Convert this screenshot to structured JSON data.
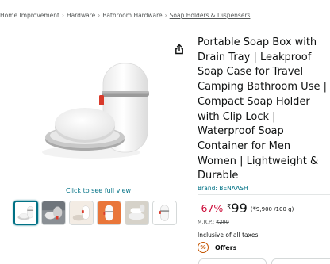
{
  "breadcrumb": [
    {
      "label": "Home Improvement"
    },
    {
      "label": "Hardware"
    },
    {
      "label": "Bathroom Hardware"
    },
    {
      "label": "Soap Holders & Dispensers"
    }
  ],
  "breadcrumb_separator": "›",
  "gallery": {
    "see_full_view": "Click to see full view",
    "thumbnail_count": 6,
    "active_thumbnail": 1
  },
  "product": {
    "title": "Portable Soap Box with Drain Tray | Leakproof Soap Case for Travel Camping Bathroom Use | Compact Soap Holder with Clip Lock | Waterproof Soap Container for Men Women | Lightweight & Durable",
    "brand": "Brand: BENAASH"
  },
  "pricing": {
    "discount": "-67%",
    "currency": "₹",
    "price": "99",
    "unit_price": "(₹9,900 /100 g)",
    "mrp_label": "M.R.P.:",
    "mrp_value": "₹299",
    "tax_note": "Inclusive of all taxes"
  },
  "offers": {
    "badge": "%",
    "label": "Offers"
  },
  "colors": {
    "link": "#007185",
    "discount": "#CC0C39",
    "offer_badge": "#C45500",
    "accent_clip": "#d93a2b"
  }
}
